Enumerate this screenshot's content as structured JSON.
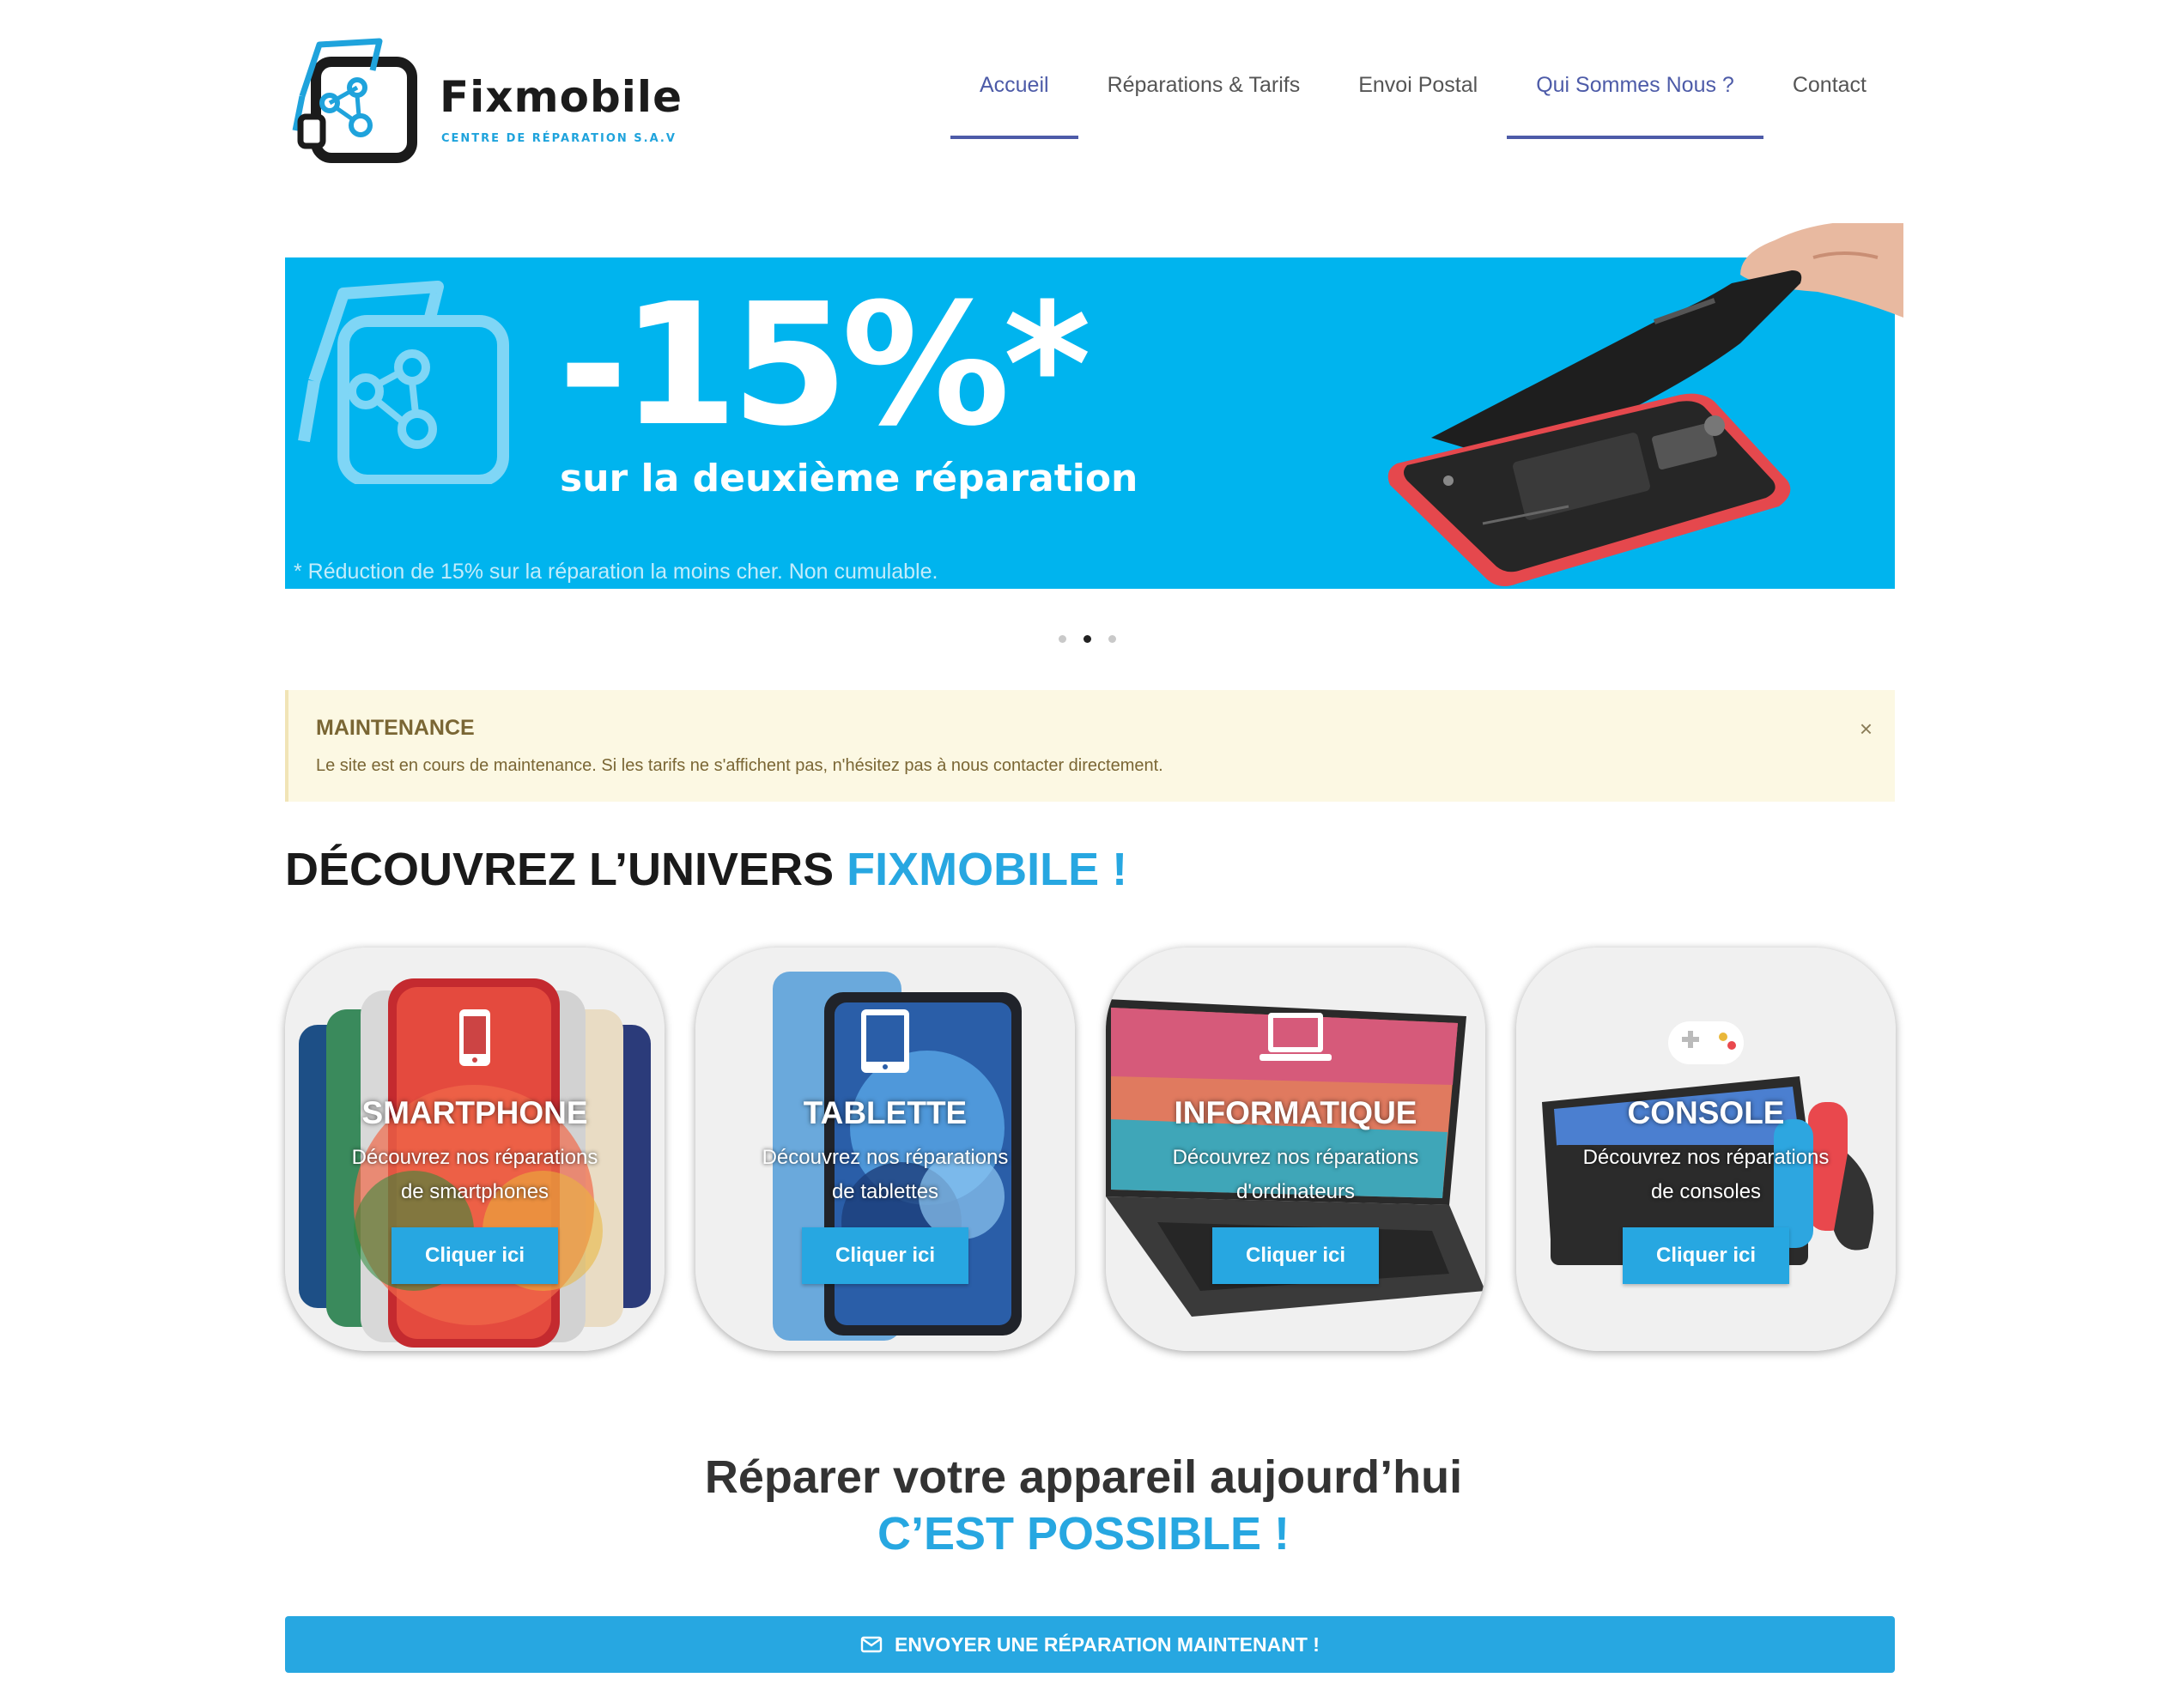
{
  "brand": {
    "name": "Fixmobile",
    "tagline": "CENTRE DE RÉPARATION S.A.V",
    "accent": "#27a7e1",
    "nav_accent": "#4d5ba8"
  },
  "nav": {
    "items": [
      {
        "label": "Accueil",
        "active": true
      },
      {
        "label": "Réparations & Tarifs",
        "active": false
      },
      {
        "label": "Envoi Postal",
        "active": false
      },
      {
        "label": "Qui Sommes Nous ?",
        "active": true
      },
      {
        "label": "Contact",
        "active": false
      }
    ]
  },
  "banner": {
    "promo": "-15%*",
    "subtitle": "sur la deuxième réparation",
    "note": "* Réduction de 15% sur la réparation la moins cher. Non cumulable.",
    "background": "#00b4ee",
    "slides_total": 3,
    "slide_active": 2
  },
  "alert": {
    "title": "MAINTENANCE",
    "text": "Le site est en cours de maintenance. Si les tarifs ne s'affichent pas, n'hésitez pas à nous contacter directement.",
    "close_icon": "×",
    "background": "#fcf8e3"
  },
  "section": {
    "title_main": "DÉCOUVREZ L’UNIVERS ",
    "title_accent": "FIXMOBILE !"
  },
  "cards": [
    {
      "title": "SMARTPHONE",
      "desc_line1": "Découvrez nos réparations",
      "desc_line2": "de smartphones",
      "button": "Cliquer ici",
      "icon": "smartphone-icon"
    },
    {
      "title": "TABLETTE",
      "desc_line1": "Découvrez nos réparations",
      "desc_line2": "de tablettes",
      "button": "Cliquer ici",
      "icon": "tablet-icon"
    },
    {
      "title": "INFORMATIQUE",
      "desc_line1": "Découvrez nos réparations",
      "desc_line2": "d'ordinateurs",
      "button": "Cliquer ici",
      "icon": "laptop-icon"
    },
    {
      "title": "CONSOLE",
      "desc_line1": "Découvrez nos réparations",
      "desc_line2": "de consoles",
      "button": "Cliquer ici",
      "icon": "gamepad-icon"
    }
  ],
  "cta": {
    "line1": "Réparer votre appareil aujourd’hui",
    "line2": "C’EST POSSIBLE !",
    "button": "ENVOYER UNE RÉPARATION MAINTENANT !",
    "button_icon": "envelope-icon"
  }
}
